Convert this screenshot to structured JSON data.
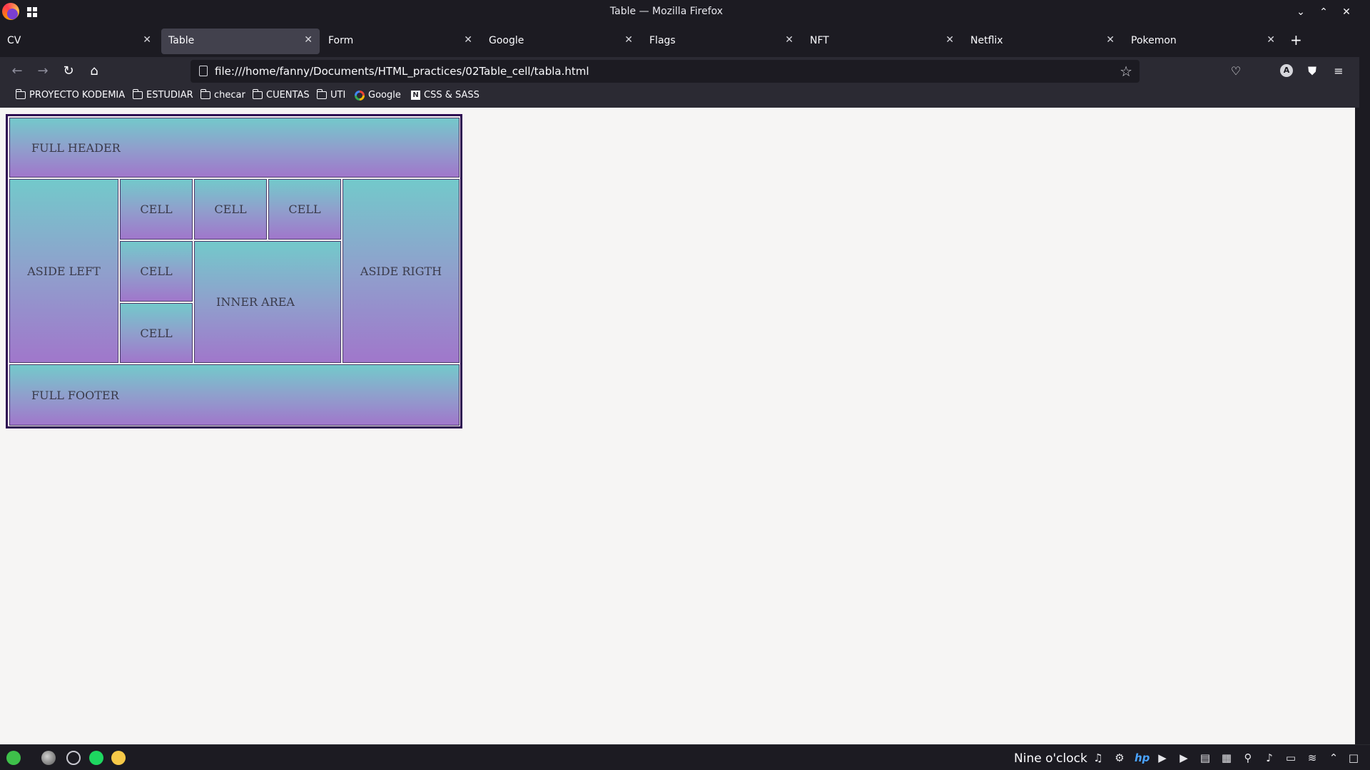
{
  "window": {
    "title": "Table — Mozilla Firefox",
    "controls": {
      "minimize": "⌄",
      "maximize": "⌃",
      "close": "✕"
    }
  },
  "tabs": [
    {
      "label": "CV",
      "selected": false
    },
    {
      "label": "Table",
      "selected": true
    },
    {
      "label": "Form",
      "selected": false
    },
    {
      "label": "Google",
      "selected": false
    },
    {
      "label": "Flags",
      "selected": false
    },
    {
      "label": "NFT",
      "selected": false
    },
    {
      "label": "Netflix",
      "selected": false
    },
    {
      "label": "Pokemon",
      "selected": false
    }
  ],
  "tab_close_glyph": "✕",
  "new_tab_glyph": "+",
  "navbar": {
    "back": "←",
    "forward": "→",
    "reload": "↻",
    "home": "⌂",
    "url": "file:///home/fanny/Documents/HTML_practices/02Table_cell/tabla.html",
    "star": "☆",
    "pocket": "♡",
    "account_initial": "A",
    "shield": "⛊",
    "menu": "≡"
  },
  "bookmarks": [
    {
      "label": "PROYECTO KODEMIA",
      "icon": "folder-icon"
    },
    {
      "label": "ESTUDIAR",
      "icon": "folder-icon"
    },
    {
      "label": "checar",
      "icon": "folder-icon"
    },
    {
      "label": "CUENTAS",
      "icon": "folder-icon"
    },
    {
      "label": "UTI",
      "icon": "folder-icon"
    },
    {
      "label": "Google",
      "icon": "google-icon"
    },
    {
      "label": "CSS & SASS",
      "icon": "notion-icon"
    }
  ],
  "notion_glyph": "N",
  "table": {
    "header": "FULL HEADER",
    "aside_left": "ASIDE LEFT",
    "aside_right": "ASIDE RIGTH",
    "cells": [
      "CELL",
      "CELL",
      "CELL",
      "CELL",
      "CELL"
    ],
    "inner_area": "INNER AREA",
    "footer": "FULL FOOTER"
  },
  "taskbar": {
    "clock": "Nine o'clock"
  },
  "colors": {
    "gradient_top": "#73c9cb",
    "gradient_bottom": "#a077cb",
    "table_border": "#2e0a52",
    "page_background": "#f6f5f4",
    "chrome_dark": "#1c1b22",
    "chrome_mid": "#2b2a33"
  }
}
